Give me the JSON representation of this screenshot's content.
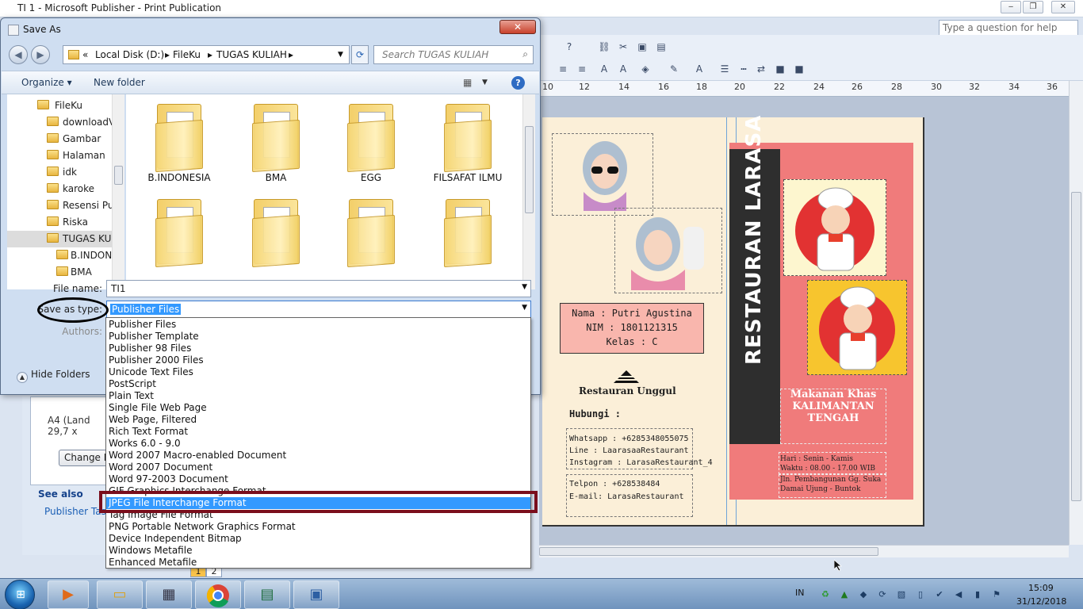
{
  "app": {
    "title": "TI 1 - Microsoft Publisher - Print Publication",
    "help_placeholder": "Type a question for help",
    "window_controls": [
      "‒",
      "❐",
      "✕"
    ]
  },
  "ruler": {
    "numbers": [
      "10",
      "12",
      "14",
      "16",
      "18",
      "20",
      "22",
      "24",
      "26",
      "28",
      "30",
      "32",
      "34",
      "36"
    ]
  },
  "task_pane": {
    "paper": "A4 (Land",
    "paper_size": "29,7 x",
    "change_button": "Change Pa",
    "see_also": "See also",
    "publisher_tasks": "Publisher Tasks"
  },
  "page_tabs": [
    "1",
    "2"
  ],
  "brochure": {
    "name_line": "Nama : Putri Agustina",
    "nim_line": "NIM : 1801121315",
    "kelas_line": "Kelas : C",
    "restaurant_caption": "Restauran Unggul",
    "hubungi": "Hubungi :",
    "contact_lines": [
      "Whatsapp : +6285348055075",
      "Line : LaarasaaRestaurant",
      "Instagram : LarasaRestaurant_4"
    ],
    "phone_lines": [
      "Telpon : +628538484",
      "E-mail: LarasaRestaurant"
    ],
    "vertical_title": "RESTAURAN LARASA",
    "food_text": [
      "Makanan Khas",
      "KALIMANTAN",
      "TENGAH"
    ],
    "hours": [
      "Hari : Senin - Kamis",
      "Waktu : 08.00 - 17.00 WIB"
    ],
    "address": [
      "Jln. Pembangunan Gg. Suka",
      "Damai Ujung - Buntok"
    ]
  },
  "dialog": {
    "title": "Save As",
    "close": "✕",
    "address_crumbs": [
      "«",
      "Local Disk (D:)",
      "▸",
      "FileKu",
      "▸",
      "TUGAS KULIAH",
      "▸"
    ],
    "search_placeholder": "Search TUGAS KULIAH",
    "organize": "Organize ▾",
    "new_folder": "New folder",
    "tree": [
      {
        "label": "FileKu",
        "indent": 1
      },
      {
        "label": "downloadV",
        "indent": 2
      },
      {
        "label": "Gambar",
        "indent": 2
      },
      {
        "label": "Halaman",
        "indent": 2
      },
      {
        "label": "idk",
        "indent": 2
      },
      {
        "label": "karoke",
        "indent": 2
      },
      {
        "label": "Resensi Puis",
        "indent": 2
      },
      {
        "label": "Riska",
        "indent": 2
      },
      {
        "label": "TUGAS KUL",
        "indent": 2,
        "selected": true
      },
      {
        "label": "B.INDONE",
        "indent": 3
      },
      {
        "label": "BMA",
        "indent": 3
      }
    ],
    "folders": [
      "B.INDONESIA",
      "BMA",
      "EGG",
      "FILSAFAT ILMU"
    ],
    "file_name_label": "File name:",
    "file_name_value": "TI1",
    "save_type_label": "Save as type:",
    "save_type_value": "Publisher Files",
    "authors_label": "Authors:",
    "hide_folders": "Hide Folders"
  },
  "save_types": [
    "Publisher Files",
    "Publisher Template",
    "Publisher 98 Files",
    "Publisher 2000 Files",
    "Unicode Text Files",
    "PostScript",
    "Plain Text",
    "Single File Web Page",
    "Web Page, Filtered",
    "Rich Text Format",
    "Works 6.0 - 9.0",
    "Word 2007 Macro-enabled Document",
    "Word 2007 Document",
    "Word 97-2003 Document",
    "GIF Graphics Interchange Format",
    "JPEG File Interchange Format",
    "Tag Image File Format",
    "PNG Portable Network Graphics Format",
    "Device Independent Bitmap",
    "Windows Metafile",
    "Enhanced Metafile"
  ],
  "highlighted_type_index": 15,
  "taskbar": {
    "language": "IN",
    "time": "15:09",
    "date": "31/12/2018"
  }
}
